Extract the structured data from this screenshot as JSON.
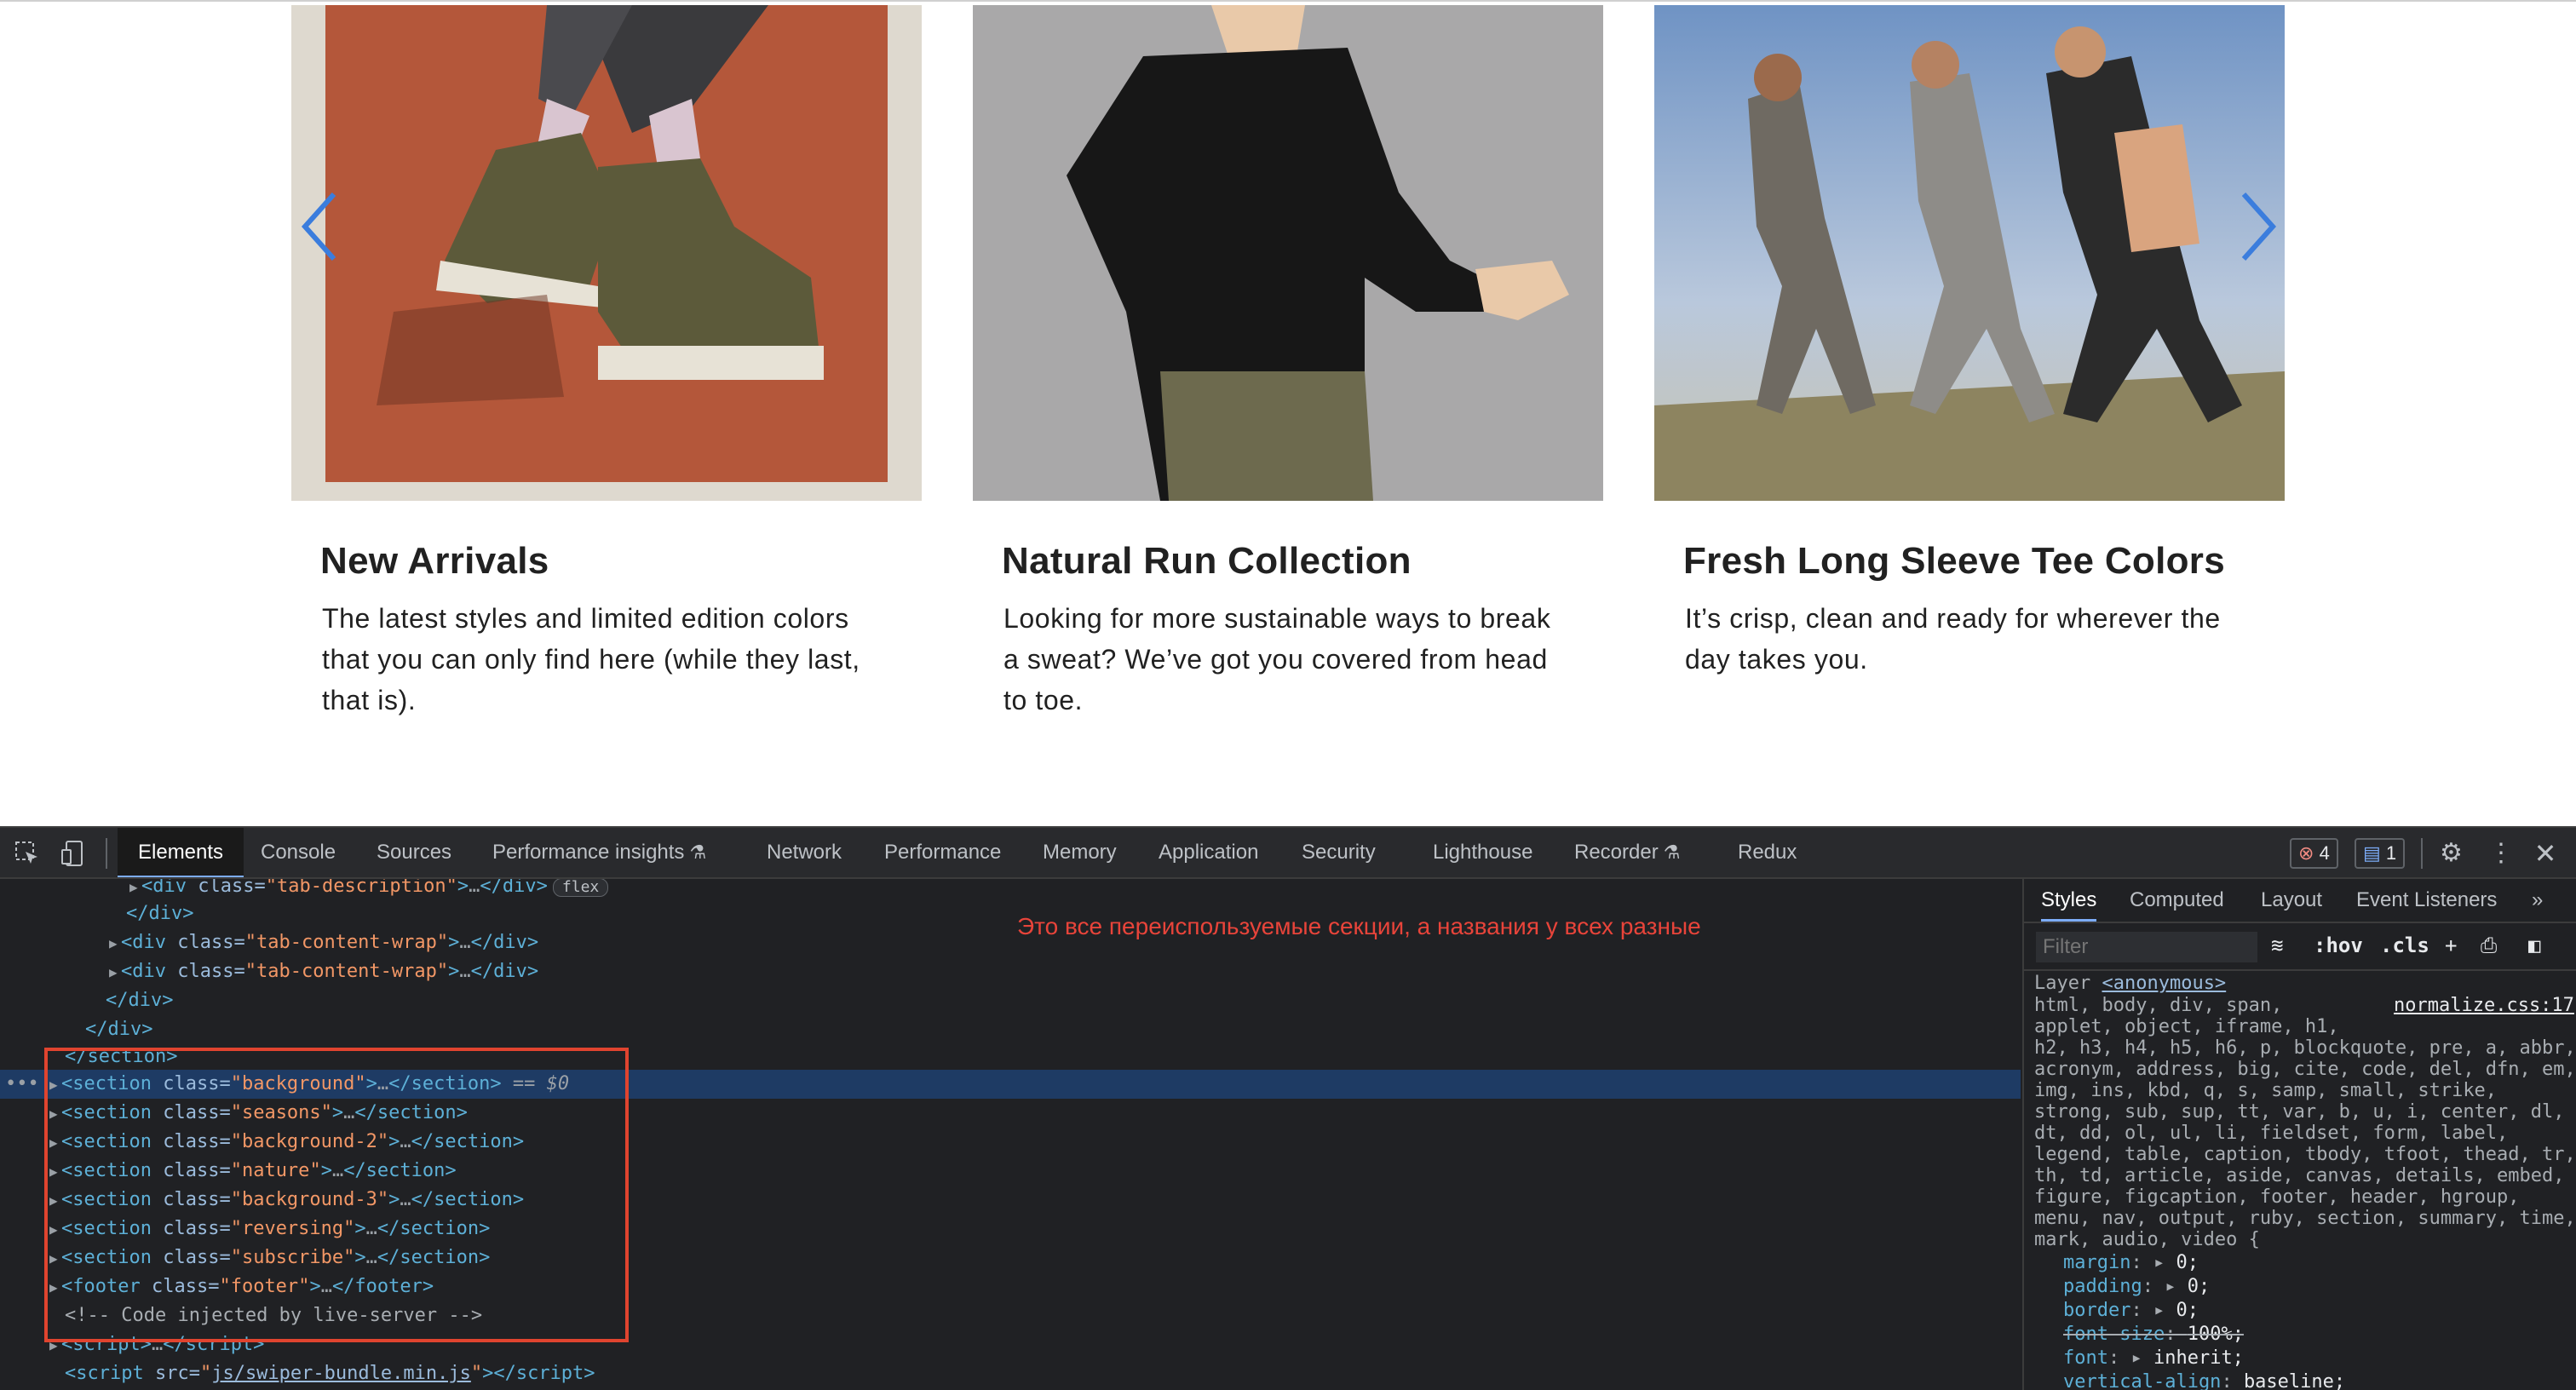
{
  "cards": [
    {
      "title": "New Arrivals",
      "text_lines": [
        "The latest styles and limited edition colors",
        "that you can only find here (while they last,",
        "that is)."
      ]
    },
    {
      "title": "Natural Run Collection",
      "text_lines": [
        "Looking for more sustainable ways to break",
        "a sweat? We’ve got you covered from head",
        "to toe."
      ]
    },
    {
      "title": "Fresh Long Sleeve Tee Colors",
      "text_lines": [
        "It’s crisp, clean and ready for wherever the",
        "day takes you."
      ]
    }
  ],
  "colors": {
    "arrow": "#3b7ddd",
    "card1_bg": "#b4573a",
    "card2_bg": "#a9a8a9",
    "devtools_bg": "#202124",
    "annotation": "#e8443a"
  },
  "devtools": {
    "tabs": {
      "elements": "Elements",
      "console": "Console",
      "sources": "Sources",
      "performance_insights": "Performance insights",
      "network": "Network",
      "performance": "Performance",
      "memory": "Memory",
      "application": "Application",
      "security": "Security",
      "lighthouse": "Lighthouse",
      "recorder": "Recorder",
      "redux": "Redux"
    },
    "errors_count": "4",
    "messages_count": "1",
    "annotation": "Это все переиспользуемые секции, а названия у всех разные",
    "dom": {
      "tab_description": "tab-description",
      "tab_content_wrap": "tab-content-wrap",
      "flex": "flex",
      "sections": [
        "background",
        "seasons",
        "background-2",
        "nature",
        "background-3",
        "reversing",
        "subscribe"
      ],
      "footer_class": "footer",
      "comment": "<!-- Code injected by live-server -->",
      "script_src": "js/swiper-bundle.min.js",
      "selected_marker": "== $0"
    },
    "styles": {
      "tabs": [
        "Styles",
        "Computed",
        "Layout",
        "Event Listeners"
      ],
      "filter_placeholder": "Filter",
      "hov": ":hov",
      "cls": ".cls",
      "layer_label": "Layer",
      "layer_value": "<anonymous>",
      "source": "normalize.css:17",
      "selector_lines": [
        "html, body, div, span,",
        "applet, object, iframe, h1,",
        "h2, h3, h4, h5, h6, p, blockquote, pre, a, abbr,",
        "acronym, address, big, cite, code, del, dfn, em,",
        "img, ins, kbd, q, s, samp, small, strike,",
        "strong, sub, sup, tt, var, b, u, i, center, dl,",
        "dt, dd, ol, ul, li, fieldset, form, label,",
        "legend, table, caption, tbody, tfoot, thead, tr,",
        "th, td, article, aside, canvas, details, embed,",
        "figure, figcaption, footer, header, hgroup,",
        "menu, nav, output, ruby, section, summary, time,",
        "mark, audio, video {"
      ],
      "declarations": [
        {
          "prop": "margin",
          "value": "0;"
        },
        {
          "prop": "padding",
          "value": "0;"
        },
        {
          "prop": "border",
          "value": "0;"
        },
        {
          "prop": "font-size",
          "value": "100%;"
        },
        {
          "prop": "font",
          "value": "inherit;"
        },
        {
          "prop": "vertical-align",
          "value": "baseline;"
        }
      ]
    }
  }
}
